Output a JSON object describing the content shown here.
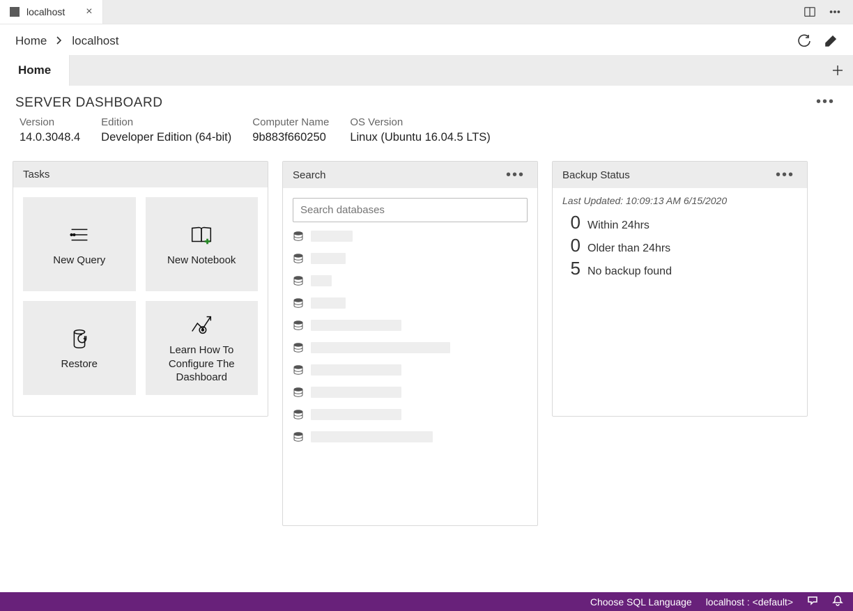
{
  "editorTab": {
    "title": "localhost"
  },
  "breadcrumb": {
    "root": "Home",
    "current": "localhost"
  },
  "innerTab": {
    "label": "Home"
  },
  "dashboard": {
    "title": "SERVER DASHBOARD",
    "props": {
      "version": {
        "label": "Version",
        "value": "14.0.3048.4"
      },
      "edition": {
        "label": "Edition",
        "value": "Developer Edition (64-bit)"
      },
      "computer": {
        "label": "Computer Name",
        "value": "9b883f660250"
      },
      "os": {
        "label": "OS Version",
        "value": "Linux (Ubuntu 16.04.5 LTS)"
      }
    }
  },
  "tasks": {
    "title": "Tasks",
    "tiles": {
      "newQuery": "New Query",
      "newNotebook": "New Notebook",
      "restore": "Restore",
      "configure": "Learn How To Configure The Dashboard"
    }
  },
  "search": {
    "title": "Search",
    "placeholder": "Search databases",
    "itemWidths": [
      60,
      50,
      30,
      50,
      130,
      200,
      130,
      130,
      130,
      175
    ]
  },
  "backup": {
    "title": "Backup Status",
    "updated": "Last Updated: 10:09:13 AM 6/15/2020",
    "rows": [
      {
        "n": "0",
        "t": "Within 24hrs"
      },
      {
        "n": "0",
        "t": "Older than 24hrs"
      },
      {
        "n": "5",
        "t": "No backup found"
      }
    ]
  },
  "statusbar": {
    "lang": "Choose SQL Language",
    "conn": "localhost : <default>"
  }
}
